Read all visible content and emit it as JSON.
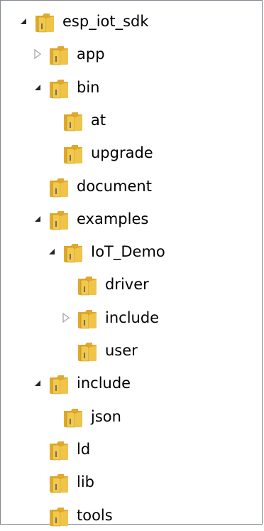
{
  "tree": {
    "items": [
      {
        "label": "esp_iot_sdk",
        "toggle": "expanded",
        "depth": 0
      },
      {
        "label": "app",
        "toggle": "collapsed",
        "depth": 1
      },
      {
        "label": "bin",
        "toggle": "expanded",
        "depth": 1
      },
      {
        "label": "at",
        "toggle": "none",
        "depth": 2
      },
      {
        "label": "upgrade",
        "toggle": "none",
        "depth": 2
      },
      {
        "label": "document",
        "toggle": "none",
        "depth": 1
      },
      {
        "label": "examples",
        "toggle": "expanded",
        "depth": 1
      },
      {
        "label": "IoT_Demo",
        "toggle": "expanded",
        "depth": 2
      },
      {
        "label": "driver",
        "toggle": "none",
        "depth": 3
      },
      {
        "label": "include",
        "toggle": "collapsed",
        "depth": 3
      },
      {
        "label": "user",
        "toggle": "none",
        "depth": 3
      },
      {
        "label": "include",
        "toggle": "expanded",
        "depth": 1
      },
      {
        "label": "json",
        "toggle": "none",
        "depth": 2
      },
      {
        "label": "ld",
        "toggle": "none",
        "depth": 1
      },
      {
        "label": "lib",
        "toggle": "none",
        "depth": 1
      },
      {
        "label": "tools",
        "toggle": "none",
        "depth": 1
      }
    ]
  },
  "colors": {
    "folder_front": "#F2C94C",
    "folder_back": "#E0A82E",
    "folder_edge": "#B8860B",
    "pane_border": "#828790",
    "toggle_expanded": "#262626",
    "toggle_collapsed": "#A6A6A6"
  }
}
